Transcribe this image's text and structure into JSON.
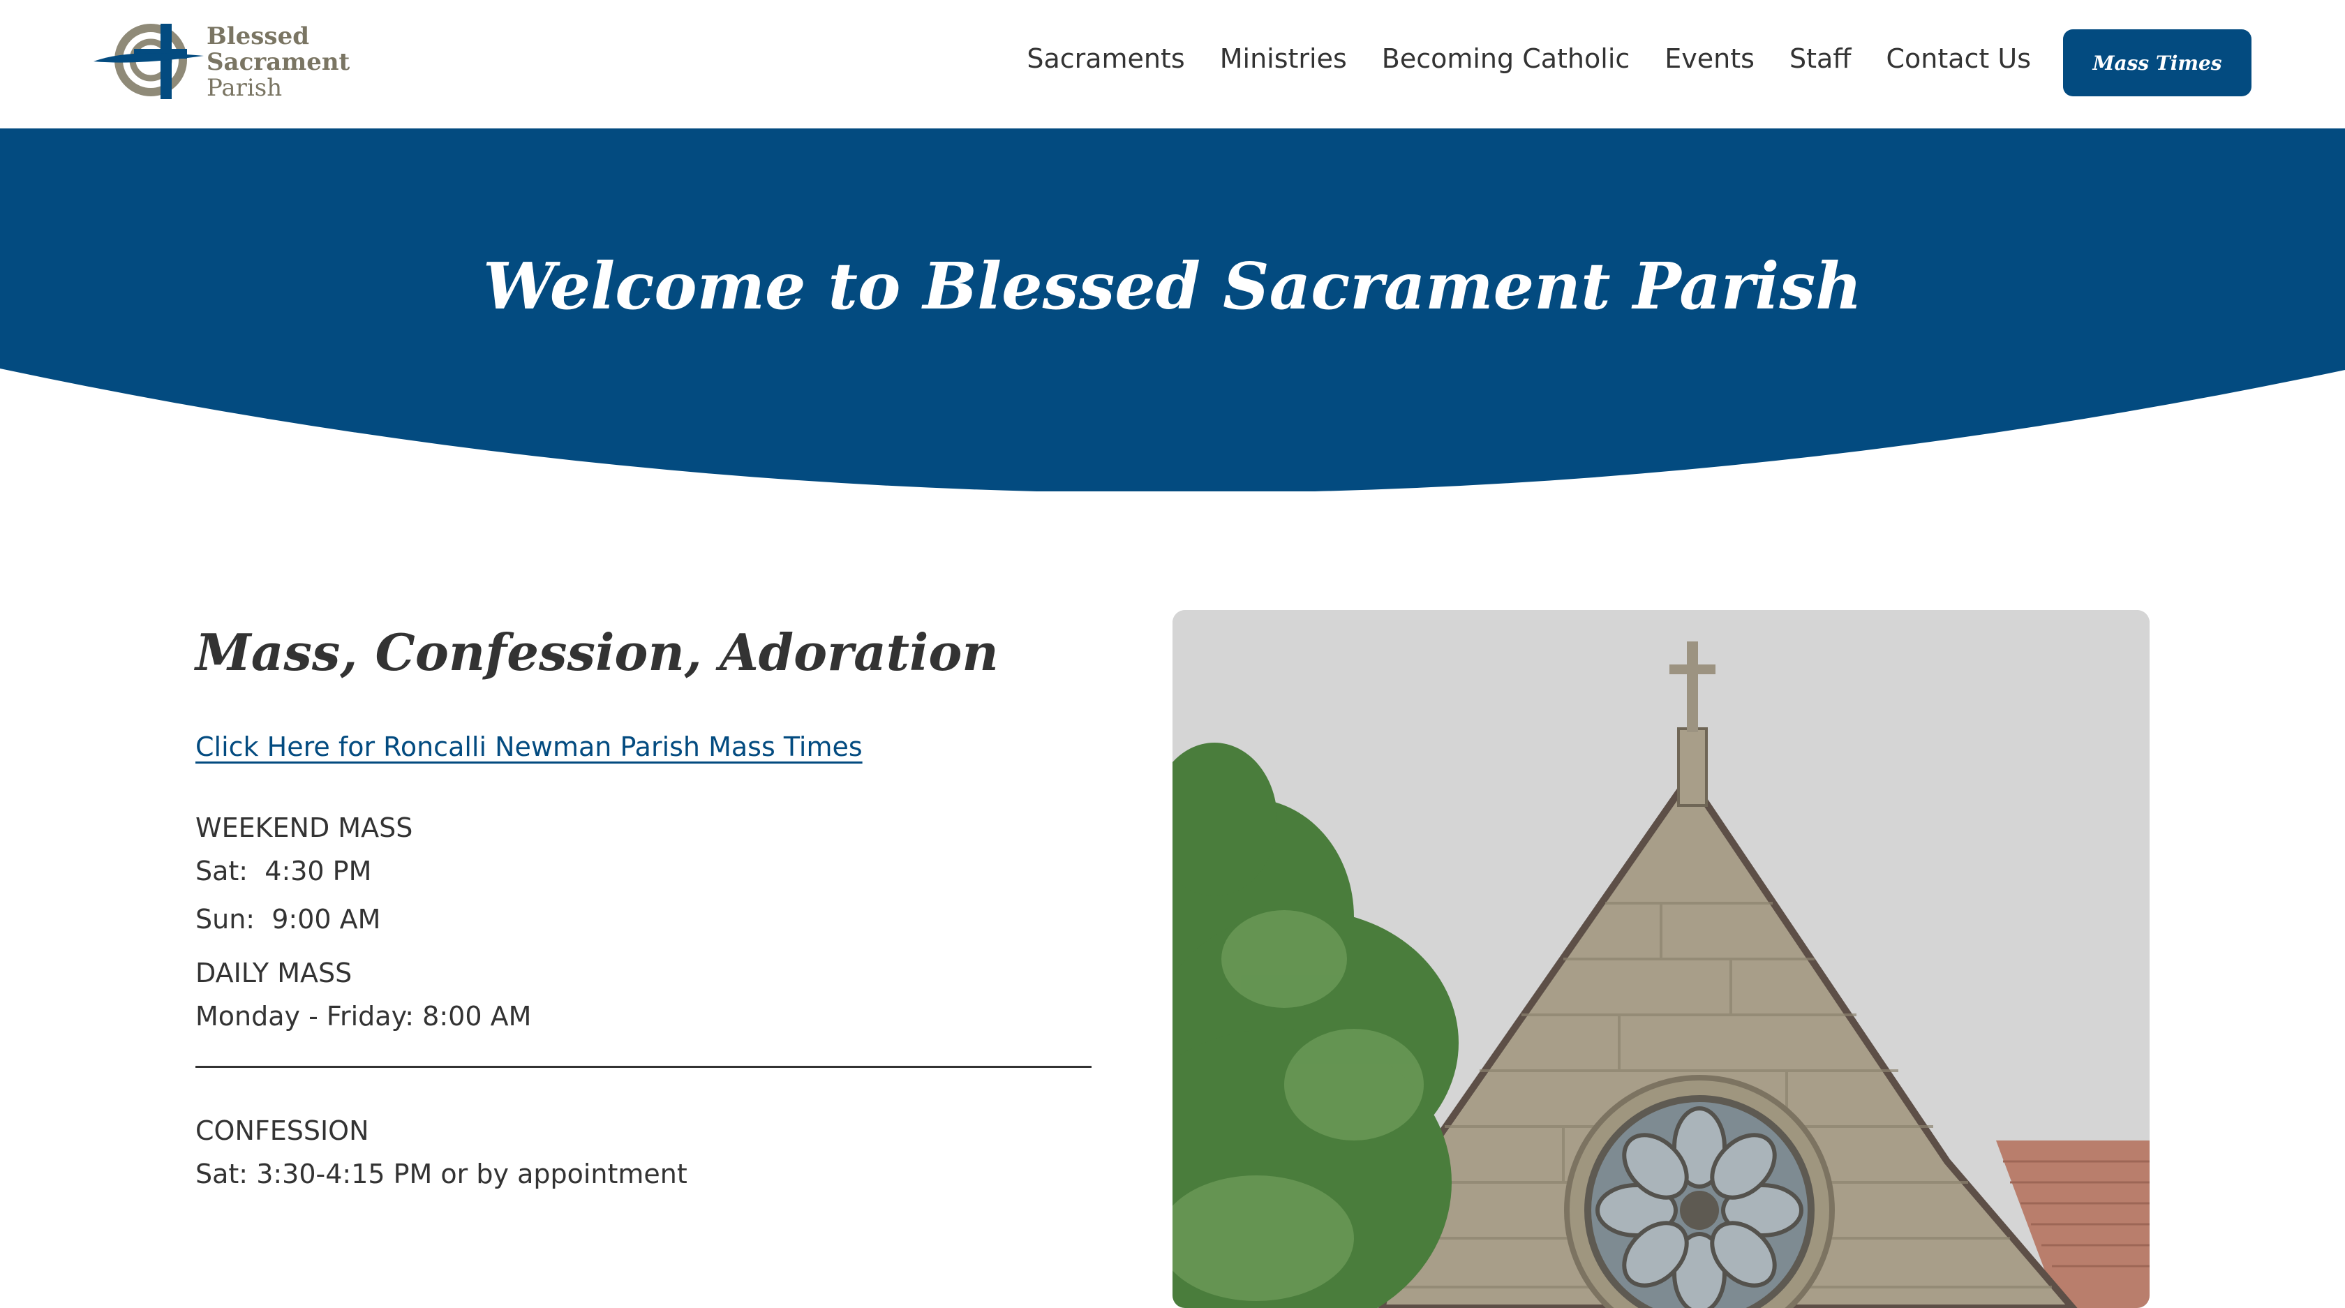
{
  "logo": {
    "line1": "Blessed",
    "line2": "Sacrament",
    "line3": "Parish"
  },
  "nav": {
    "items": [
      {
        "label": "Sacraments"
      },
      {
        "label": "Ministries"
      },
      {
        "label": "Becoming Catholic"
      },
      {
        "label": "Events"
      },
      {
        "label": "Staff"
      },
      {
        "label": "Contact Us"
      }
    ],
    "cta_label": "Mass Times"
  },
  "hero": {
    "title": "Welcome to Blessed Sacrament Parish"
  },
  "schedule": {
    "title": "Mass, Confession, Adoration",
    "link": "Click Here for Roncalli Newman Parish Mass Times",
    "weekend": {
      "heading": "WEEKEND MASS",
      "times": [
        "Sat:  4:30 PM",
        "Sun:  9:00 AM"
      ]
    },
    "daily": {
      "heading": "DAILY MASS",
      "times": [
        "Monday - Friday: 8:00 AM"
      ]
    },
    "confession": {
      "heading": "CONFESSION",
      "times": [
        "Sat: 3:30-4:15 PM or by appointment"
      ]
    }
  },
  "colors": {
    "brand_blue": "#034b80",
    "logo_gold": "#7a7563",
    "text": "#333333"
  }
}
